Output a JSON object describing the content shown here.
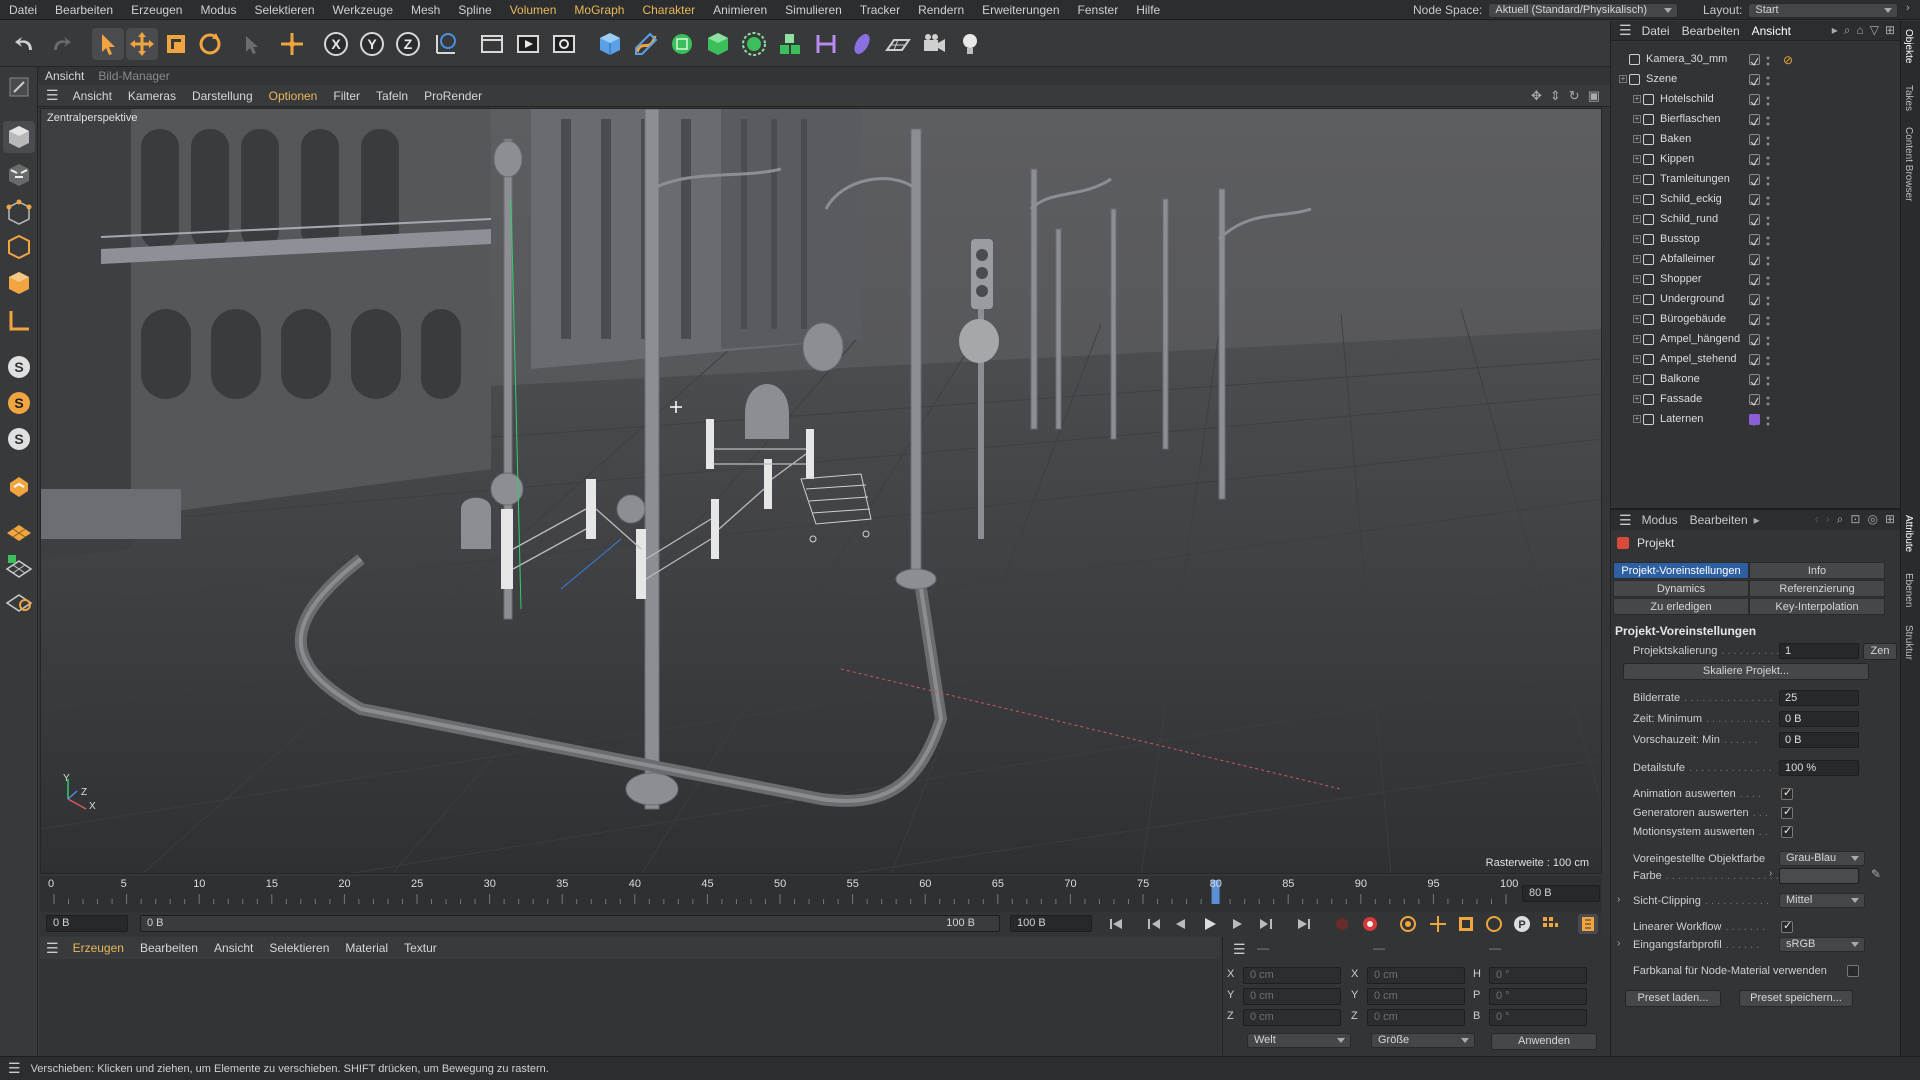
{
  "menu": {
    "items": [
      "Datei",
      "Bearbeiten",
      "Erzeugen",
      "Modus",
      "Selektieren",
      "Werkzeuge",
      "Mesh",
      "Spline",
      "Volumen",
      "MoGraph",
      "Charakter",
      "Animieren",
      "Simulieren",
      "Tracker",
      "Rendern",
      "Erweiterungen",
      "Fenster",
      "Hilfe"
    ],
    "node_space_label": "Node Space:",
    "node_space_value": "Aktuell (Standard/Physikalisch)",
    "layout_label": "Layout:",
    "layout_value": "Start"
  },
  "viewport_tabs": {
    "active": "Ansicht",
    "inactive": "Bild-Manager"
  },
  "viewport_menu": [
    "Ansicht",
    "Kameras",
    "Darstellung",
    "Optionen",
    "Filter",
    "Tafeln",
    "ProRender"
  ],
  "viewport": {
    "label": "Zentralperspektive",
    "grid_info": "Rasterweite : 100 cm",
    "axis_y": "Y",
    "axis_z": "Z",
    "axis_x": "X"
  },
  "timeline": {
    "ticks": [
      "0",
      "5",
      "10",
      "15",
      "20",
      "25",
      "30",
      "35",
      "40",
      "45",
      "50",
      "55",
      "60",
      "65",
      "70",
      "75",
      "80",
      "85",
      "90",
      "95",
      "100"
    ],
    "current_frame": 80,
    "current_field": "80 B",
    "start_field": "0 B",
    "start_field2": "0 B",
    "end_field": "100 B",
    "end_field2": "100 B"
  },
  "material_menu": [
    "Erzeugen",
    "Bearbeiten",
    "Ansicht",
    "Selektieren",
    "Material",
    "Textur"
  ],
  "coordinates": {
    "header_dashes": [
      "—",
      "—",
      "—"
    ],
    "rows": [
      {
        "l1": "X",
        "v1": "0 cm",
        "l2": "X",
        "v2": "0 cm",
        "l3": "H",
        "v3": "0 °"
      },
      {
        "l1": "Y",
        "v1": "0 cm",
        "l2": "Y",
        "v2": "0 cm",
        "l3": "P",
        "v3": "0 °"
      },
      {
        "l1": "Z",
        "v1": "0 cm",
        "l2": "Z",
        "v2": "0 cm",
        "l3": "B",
        "v3": "0 °"
      }
    ],
    "mode1": "Welt",
    "mode2": "Größe",
    "apply": "Anwenden"
  },
  "status": "Verschieben: Klicken und ziehen, um Elemente zu verschieben. SHIFT drücken, um Bewegung zu rastern.",
  "object_manager": {
    "menu": [
      "Datei",
      "Bearbeiten",
      "Ansicht"
    ],
    "camera": "Kamera_30_mm",
    "scene": "Szene",
    "children": [
      "Hotelschild",
      "Bierflaschen",
      "Baken",
      "Kippen",
      "Tramleitungen",
      "Schild_eckig",
      "Schild_rund",
      "Busstop",
      "Abfalleimer",
      "Shopper",
      "Underground",
      "Bürogebäude",
      "Ampel_hängend",
      "Ampel_stehend",
      "Balkone",
      "Fassade",
      "Laternen"
    ]
  },
  "attributes": {
    "menu": [
      "Modus",
      "Bearbeiten"
    ],
    "title": "Projekt",
    "tabs": [
      "Projekt-Voreinstellungen",
      "Info",
      "Dynamics",
      "Referenzierung",
      "Zu erledigen",
      "Key-Interpolation"
    ],
    "section": "Projekt-Voreinstellungen",
    "scale_label": "Projektskalierung",
    "scale_value": "1",
    "scale_unit": "Zen",
    "scale_button": "Skaliere Projekt...",
    "fps_label": "Bilderrate",
    "fps_value": "25",
    "tmin_label": "Zeit: Minimum",
    "tmin_value": "0 B",
    "pmin_label": "Vorschauzeit: Min",
    "pmin_value": "0 B",
    "lod_label": "Detailstufe",
    "lod_value": "100 %",
    "anim_label": "Animation auswerten",
    "gen_label": "Generatoren auswerten",
    "motion_label": "Motionsystem auswerten",
    "objcolor_label": "Voreingestellte Objektfarbe",
    "objcolor_value": "Grau-Blau",
    "color_label": "Farbe",
    "clip_label": "Sicht-Clipping",
    "clip_value": "Mittel",
    "linear_label": "Linearer Workflow",
    "input_label": "Eingangsfarbprofil",
    "input_value": "sRGB",
    "node_label": "Farbkanal für Node-Material verwenden",
    "load_button": "Preset laden...",
    "save_button": "Preset speichern..."
  },
  "side_tabs": [
    "Objekte",
    "Takes",
    "Content Browser",
    "Attribute",
    "Ebenen",
    "Struktur"
  ],
  "colors": {
    "accent": "#e8b85a",
    "selection": "#2d5fa3",
    "laternen_tag": "#8a5fd6"
  }
}
